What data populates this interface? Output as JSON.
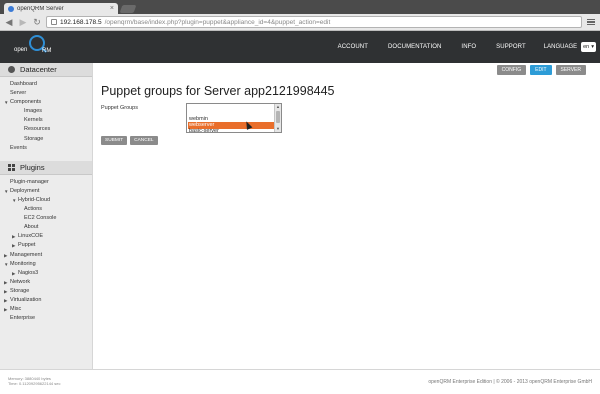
{
  "browser": {
    "tab_title": "openQRM Server",
    "url_host": "192.168.178.5",
    "url_path": "/openqrm/base/index.php?plugin=puppet&appliance_id=4&puppet_action=edit"
  },
  "header": {
    "logo_left": "open",
    "logo_right": "RM",
    "nav": [
      "ACCOUNT",
      "DOCUMENTATION",
      "INFO",
      "SUPPORT"
    ],
    "language_label": "LANGUAGE",
    "language_value": "en"
  },
  "sidebar": {
    "datacenter_title": "Datacenter",
    "datacenter_items": [
      {
        "label": "Dashboard",
        "level": 0,
        "arrow": ""
      },
      {
        "label": "Server",
        "level": 0,
        "arrow": ""
      },
      {
        "label": "Components",
        "level": 0,
        "arrow": "▼"
      },
      {
        "label": "Images",
        "level": 2,
        "arrow": ""
      },
      {
        "label": "Kernels",
        "level": 2,
        "arrow": ""
      },
      {
        "label": "Resources",
        "level": 2,
        "arrow": ""
      },
      {
        "label": "Storage",
        "level": 2,
        "arrow": ""
      },
      {
        "label": "Events",
        "level": 0,
        "arrow": ""
      }
    ],
    "plugins_title": "Plugins",
    "plugin_items": [
      {
        "label": "Plugin-manager",
        "level": 0,
        "arrow": ""
      },
      {
        "label": "Deployment",
        "level": 0,
        "arrow": "▼"
      },
      {
        "label": "Hybrid-Cloud",
        "level": 1,
        "arrow": "▼"
      },
      {
        "label": "Actions",
        "level": 2,
        "arrow": ""
      },
      {
        "label": "EC2 Console",
        "level": 2,
        "arrow": ""
      },
      {
        "label": "About",
        "level": 2,
        "arrow": ""
      },
      {
        "label": "LinuxCOE",
        "level": 1,
        "arrow": "▶"
      },
      {
        "label": "Puppet",
        "level": 1,
        "arrow": "▶"
      },
      {
        "label": "Management",
        "level": 0,
        "arrow": "▶"
      },
      {
        "label": "Monitoring",
        "level": 0,
        "arrow": "▼"
      },
      {
        "label": "Nagios3",
        "level": 1,
        "arrow": "▶"
      },
      {
        "label": "Network",
        "level": 0,
        "arrow": "▶"
      },
      {
        "label": "Storage",
        "level": 0,
        "arrow": "▶"
      },
      {
        "label": "Virtualization",
        "level": 0,
        "arrow": "▶"
      },
      {
        "label": "Misc",
        "level": 0,
        "arrow": "▶"
      },
      {
        "label": "Enterprise",
        "level": 0,
        "arrow": ""
      }
    ]
  },
  "main": {
    "subnav": [
      {
        "label": "CONFIG",
        "active": false
      },
      {
        "label": "EDIT",
        "active": true
      },
      {
        "label": "SERVER",
        "active": false
      }
    ],
    "title": "Puppet groups for Server app2121998445",
    "field_label": "Puppet Groups",
    "options": [
      {
        "label": "",
        "selected": false
      },
      {
        "label": "",
        "selected": false
      },
      {
        "label": "webmin",
        "selected": false
      },
      {
        "label": "webserver",
        "selected": true
      },
      {
        "label": "basic-server",
        "selected": false
      }
    ],
    "submit_label": "SUBMIT",
    "cancel_label": "CANCEL"
  },
  "footer": {
    "memory": "Memory: 3880440 bytes",
    "time": "Time: 0.11209295622144 sec",
    "copyright": "openQRM Enterprise Edition | © 2006 - 2013 openQRM Enterprise GmbH"
  }
}
